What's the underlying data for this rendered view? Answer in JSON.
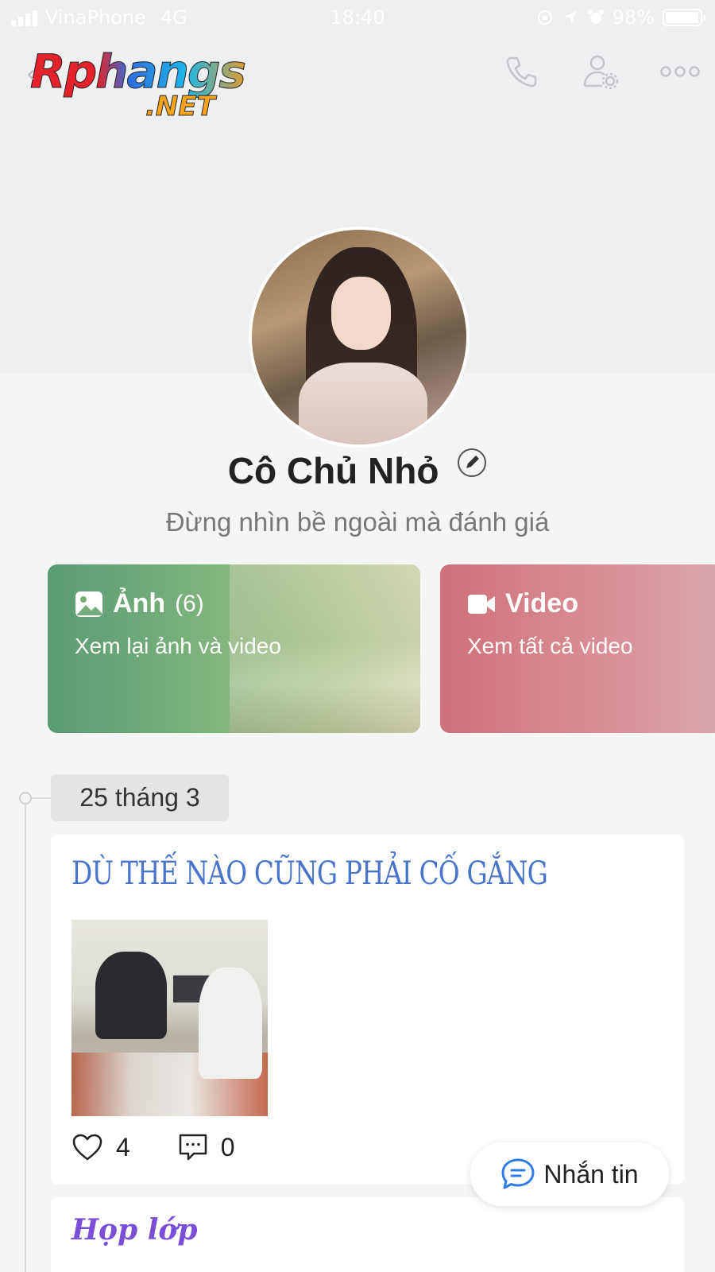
{
  "status_bar": {
    "carrier": "VinaPhone",
    "network": "4G",
    "time": "18:40",
    "battery": "98%",
    "battery_level": 0.98,
    "icons": [
      "signal-icon",
      "rotation-lock-icon",
      "location-arrow-icon",
      "alarm-icon",
      "battery-icon"
    ]
  },
  "logo": {
    "word": "Rphangs",
    "tld": ".NET",
    "back_glyph": "‹"
  },
  "header_actions": [
    {
      "name": "call-button",
      "icon": "phone-icon"
    },
    {
      "name": "profile-settings-button",
      "icon": "user-settings-icon"
    },
    {
      "name": "more-button",
      "icon": "more-dots-icon"
    }
  ],
  "profile": {
    "name": "Cô Chủ Nhỏ",
    "bio": "Đừng nhìn bề ngoài mà đánh giá",
    "edit_icon": "pencil-icon"
  },
  "cards": {
    "photo": {
      "title": "Ảnh",
      "count": "(6)",
      "subtitle": "Xem lại ảnh và video",
      "icon": "image-icon",
      "color": "#5a9a74"
    },
    "video": {
      "title": "Video",
      "subtitle": "Xem tất cả video",
      "icon": "video-camera-icon",
      "color": "#d0707d"
    }
  },
  "timeline": {
    "date": "25 tháng 3"
  },
  "post": {
    "title": "DÙ THẾ NÀO CŨNG PHẢI CỐ GẮNG",
    "likes": "4",
    "comments": "0",
    "like_icon": "heart-icon",
    "comment_icon": "comment-icon",
    "title_color": "#4a74c9"
  },
  "post2": {
    "title": "Họp lớp",
    "title_color": "#7a4fd8"
  },
  "fab": {
    "label": "Nhắn tin",
    "icon": "chat-bubble-icon",
    "accent": "#2f7be8"
  }
}
